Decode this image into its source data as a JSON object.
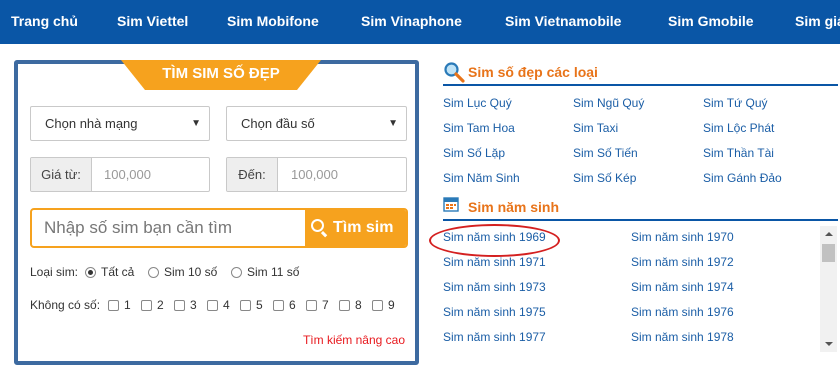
{
  "nav": {
    "items": [
      "Trang chủ",
      "Sim Viettel",
      "Sim Mobifone",
      "Sim Vinaphone",
      "Sim Vietnamobile",
      "Sim Gmobile",
      "Sim giá"
    ]
  },
  "search_panel": {
    "title": "TÌM SIM SỐ ĐẸP",
    "network_select": "Chọn nhà mạng",
    "prefix_select": "Chọn đầu số",
    "price_from_label": "Giá từ:",
    "price_from_value": "100,000",
    "price_to_label": "Đến:",
    "price_to_value": "100,000",
    "search_placeholder": "Nhập số sim bạn cần tìm",
    "search_button": "Tìm sim",
    "sim_type_label": "Loại sim:",
    "sim_type_options": [
      "Tất cả",
      "Sim 10 số",
      "Sim 11 số"
    ],
    "sim_type_selected": "Tất cả",
    "exclude_label": "Không có số:",
    "exclude_digits": [
      "1",
      "2",
      "3",
      "4",
      "5",
      "6",
      "7",
      "8",
      "9"
    ],
    "advanced_link": "Tìm kiếm nâng cao"
  },
  "categories": {
    "title": "Sim số đẹp các loại",
    "items": [
      "Sim Lục Quý",
      "Sim Ngũ Quý",
      "Sim Tứ Quý",
      "Sim Tam Hoa",
      "Sim Taxi",
      "Sim Lộc Phát",
      "Sim Số Lặp",
      "Sim Số Tiến",
      "Sim Thần Tài",
      "Sim Năm Sinh",
      "Sim Số Kép",
      "Sim Gánh Đảo"
    ]
  },
  "birth_year": {
    "title": "Sim năm sinh",
    "items": [
      "Sim năm sinh 1969",
      "Sim năm sinh 1970",
      "Sim năm sinh 1971",
      "Sim năm sinh 1972",
      "Sim năm sinh 1973",
      "Sim năm sinh 1974",
      "Sim năm sinh 1975",
      "Sim năm sinh 1976",
      "Sim năm sinh 1977",
      "Sim năm sinh 1978"
    ],
    "highlighted": "Sim năm sinh 1969"
  },
  "colors": {
    "nav_bg": "#0a56a6",
    "accent_orange": "#f6a21e",
    "panel_border": "#3d6aa0",
    "link_blue": "#1b5ea6",
    "section_title": "#e8741a",
    "advanced_red": "#e8191e",
    "highlight_ring": "#d42020"
  },
  "icons": {
    "search_section": "magnifier-icon",
    "calendar_section": "calendar-icon",
    "search_button": "search-icon"
  }
}
